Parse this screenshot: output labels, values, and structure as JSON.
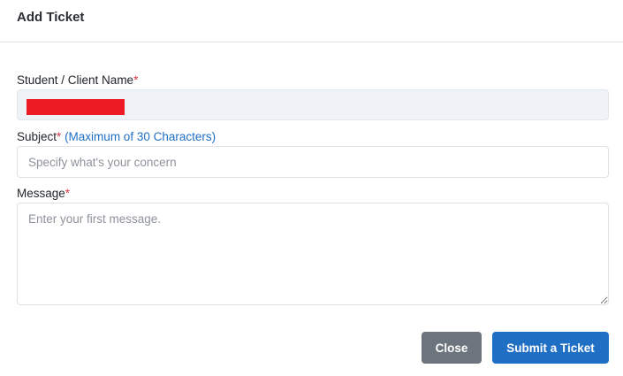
{
  "modal": {
    "title": "Add Ticket"
  },
  "form": {
    "name_field": {
      "label": "Student / Client Name",
      "required_mark": "*",
      "value": ""
    },
    "subject_field": {
      "label": "Subject",
      "required_mark": "*",
      "hint": "(Maximum of 30 Characters)",
      "placeholder": "Specify what's your concern",
      "value": ""
    },
    "message_field": {
      "label": "Message",
      "required_mark": "*",
      "placeholder": "Enter your first message.",
      "value": ""
    }
  },
  "actions": {
    "close_label": "Close",
    "submit_label": "Submit a Ticket"
  },
  "colors": {
    "primary": "#1f6fc5",
    "secondary": "#6c757d",
    "required": "#dc3545",
    "redaction": "#ed1c24"
  }
}
